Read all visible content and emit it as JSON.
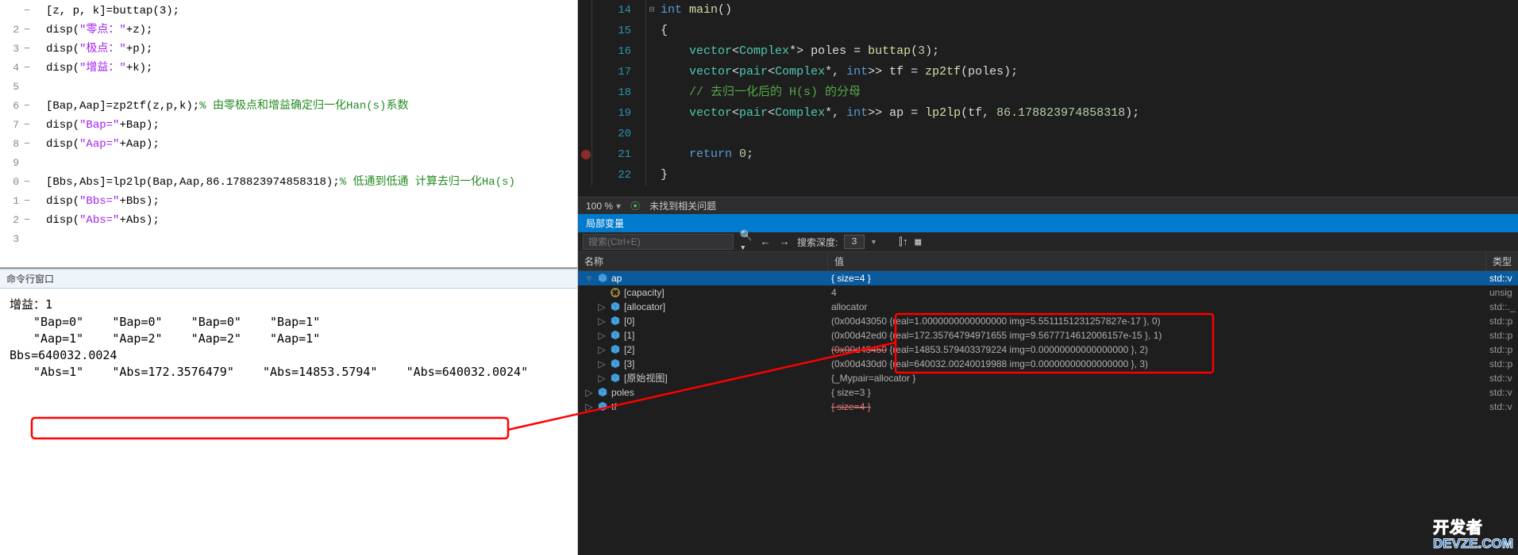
{
  "left": {
    "lines": [
      {
        "no": "",
        "dash": "−",
        "html": "[z, p, k]=buttap(<span class='m-num'>3</span>);"
      },
      {
        "no": "2",
        "dash": "−",
        "html": "disp(<span class='m-str'>\"零点：\"</span>+z);"
      },
      {
        "no": "3",
        "dash": "−",
        "html": "disp(<span class='m-str'>\"极点：\"</span>+p);"
      },
      {
        "no": "4",
        "dash": "−",
        "html": "disp(<span class='m-str'>\"增益：\"</span>+k);"
      },
      {
        "no": "5",
        "dash": "",
        "html": ""
      },
      {
        "no": "6",
        "dash": "−",
        "html": "[Bap,Aap]=zp2tf(z,p,k);<span class='m-cmt'>% 由零极点和增益确定归一化Han(s)系数</span>"
      },
      {
        "no": "7",
        "dash": "−",
        "html": "disp(<span class='m-str'>\"Bap=\"</span>+Bap);"
      },
      {
        "no": "8",
        "dash": "−",
        "html": "disp(<span class='m-str'>\"Aap=\"</span>+Aap);"
      },
      {
        "no": "9",
        "dash": "",
        "html": ""
      },
      {
        "no": "0",
        "dash": "−",
        "html": "[Bbs,Abs]=lp2lp(Bap,Aap,<span class='m-num'>86.178823974858318</span>);<span class='m-cmt'>% 低通到低通 计算去归一化Ha(s)</span>"
      },
      {
        "no": "1",
        "dash": "−",
        "html": "disp(<span class='m-str'>\"Bbs=\"</span>+Bbs);"
      },
      {
        "no": "2",
        "dash": "−",
        "html": "disp(<span class='m-str'>\"Abs=\"</span>+Abs);"
      },
      {
        "no": "3",
        "dash": "",
        "html": ""
      }
    ],
    "cmd_title": "命令行窗口",
    "output": [
      {
        "cls": "out-indent",
        "txt": ""
      },
      {
        "cls": "",
        "txt": "增益：1"
      },
      {
        "cls": "out-indent",
        "txt": "\"Bap=0\"    \"Bap=0\"    \"Bap=0\"    \"Bap=1\""
      },
      {
        "cls": "",
        "txt": ""
      },
      {
        "cls": "out-indent",
        "txt": "\"Aap=1\"    \"Aap=2\"    \"Aap=2\"    \"Aap=1\""
      },
      {
        "cls": "",
        "txt": ""
      },
      {
        "cls": "",
        "txt": "Bbs=640032.0024"
      },
      {
        "cls": "out-indent",
        "txt": "\"Abs=1\"    \"Abs=172.3576479\"    \"Abs=14853.5794\"    \"Abs=640032.0024\""
      }
    ]
  },
  "right": {
    "code": [
      {
        "no": "14",
        "fold": "⊟",
        "html": "<span class='vs-kw'>int</span> <span class='vs-fn'>main</span>()"
      },
      {
        "no": "15",
        "fold": "",
        "html": "{"
      },
      {
        "no": "16",
        "fold": "",
        "html": "    <span class='vs-type'>vector</span>&lt;<span class='vs-type'>Complex</span>*&gt; poles = <span class='vs-fn'>buttap</span>(<span class='vs-num'>3</span>);"
      },
      {
        "no": "17",
        "fold": "",
        "html": "    <span class='vs-type'>vector</span>&lt;<span class='vs-type'>pair</span>&lt;<span class='vs-type'>Complex</span>*, <span class='vs-kw'>int</span>&gt;&gt; tf = <span class='vs-fn'>zp2tf</span>(poles);"
      },
      {
        "no": "18",
        "fold": "",
        "html": "    <span class='vs-cmt'>// 去归一化后的 H(s) 的分母</span>"
      },
      {
        "no": "19",
        "fold": "",
        "html": "    <span class='vs-type'>vector</span>&lt;<span class='vs-type'>pair</span>&lt;<span class='vs-type'>Complex</span>*, <span class='vs-kw'>int</span>&gt;&gt; ap = <span class='vs-fn'>lp2lp</span>(tf, <span class='vs-num'>86.178823974858318</span>);"
      },
      {
        "no": "20",
        "fold": "",
        "html": ""
      },
      {
        "no": "21",
        "fold": "",
        "html": "    <span class='vs-kw'>return</span> <span class='vs-num'>0</span>;",
        "bp": true
      },
      {
        "no": "22",
        "fold": "",
        "html": "}"
      }
    ],
    "zoom": "100 %",
    "status_ok": "未找到相关问题",
    "locals_title": "局部变量",
    "search_placeholder": "搜索(Ctrl+E)",
    "depth_label": "搜索深度:",
    "depth_value": "3",
    "col_name": "名称",
    "col_val": "值",
    "col_type": "类型",
    "rows": [
      {
        "depth": 0,
        "exp": "▿",
        "ico": "blue",
        "name": "ap",
        "val": "{ size=4 }",
        "type": "std::v",
        "sel": true
      },
      {
        "depth": 1,
        "exp": "",
        "ico": "wrench",
        "name": "[capacity]",
        "val": "4",
        "type": "unsig"
      },
      {
        "depth": 1,
        "exp": "▷",
        "ico": "blue",
        "name": "[allocator]",
        "val": "allocator",
        "type": "std::._"
      },
      {
        "depth": 1,
        "exp": "▷",
        "ico": "blue",
        "name": "[0]",
        "val": "(0x00d43050 {real=1.0000000000000000 img=5.5511151231257827e-17 }, 0)",
        "type": "std::p"
      },
      {
        "depth": 1,
        "exp": "▷",
        "ico": "blue",
        "name": "[1]",
        "val": "(0x00d42ed0 {real=172.35764794971655 img=9.5677714612006157e-15 }, 1)",
        "type": "std::p"
      },
      {
        "depth": 1,
        "exp": "▷",
        "ico": "blue",
        "name": "[2]",
        "val": "(0x00d43450 {real=14853.579403379224 img=0.00000000000000000 }, 2)",
        "type": "std::p",
        "strike": true
      },
      {
        "depth": 1,
        "exp": "▷",
        "ico": "blue",
        "name": "[3]",
        "val": "(0x00d430d0 {real=640032.00240019988 img=0.00000000000000000 }, 3)",
        "type": "std::p"
      },
      {
        "depth": 1,
        "exp": "▷",
        "ico": "blue",
        "name": "[原始视图]",
        "val": "{_Mypair=allocator }",
        "type": "std::v"
      },
      {
        "depth": 0,
        "exp": "▷",
        "ico": "blue",
        "name": "poles",
        "val": "{ size=3 }",
        "type": "std::v"
      },
      {
        "depth": 0,
        "exp": "▷",
        "ico": "blue",
        "name": "tf",
        "val": "{ size=4 }",
        "type": "std::v",
        "strike": true
      }
    ]
  },
  "watermark": {
    "top": "开发者",
    "bottom": "DEVZE.COM"
  }
}
